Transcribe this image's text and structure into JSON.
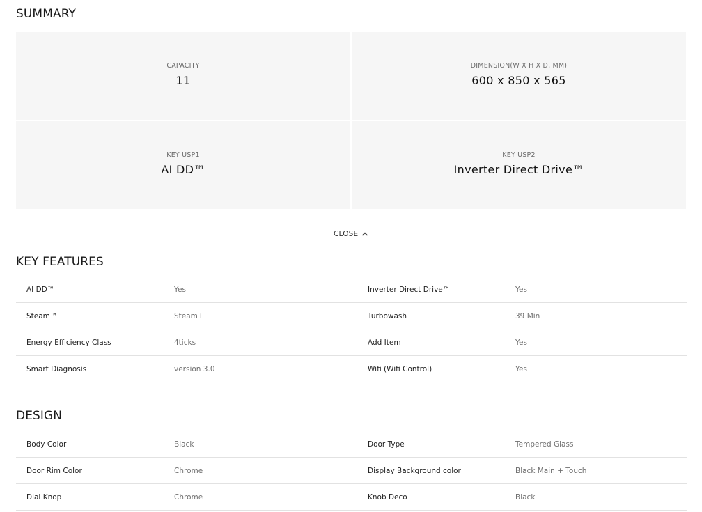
{
  "summary": {
    "title": "SUMMARY",
    "cells": [
      {
        "label": "CAPACITY",
        "value": "11"
      },
      {
        "label": "DIMENSION(W X H X D, MM)",
        "value": "600 x 850 x 565"
      },
      {
        "label": "KEY USP1",
        "value": "AI DD™"
      },
      {
        "label": "KEY USP2",
        "value": "Inverter Direct Drive™"
      }
    ],
    "close_label": "CLOSE"
  },
  "key_features": {
    "title": "KEY FEATURES",
    "rows": [
      [
        {
          "k": "AI DD™",
          "v": "Yes"
        },
        {
          "k": "Inverter Direct Drive™",
          "v": "Yes"
        }
      ],
      [
        {
          "k": "Steam™",
          "v": "Steam+"
        },
        {
          "k": "Turbowash",
          "v": "39 Min"
        }
      ],
      [
        {
          "k": "Energy Efficiency Class",
          "v": "4ticks"
        },
        {
          "k": "Add Item",
          "v": "Yes"
        }
      ],
      [
        {
          "k": "Smart Diagnosis",
          "v": "version 3.0"
        },
        {
          "k": "Wifi (Wifi Control)",
          "v": "Yes"
        }
      ]
    ]
  },
  "design": {
    "title": "DESIGN",
    "rows": [
      [
        {
          "k": "Body Color",
          "v": "Black"
        },
        {
          "k": "Door Type",
          "v": "Tempered Glass"
        }
      ],
      [
        {
          "k": "Door Rim Color",
          "v": "Chrome"
        },
        {
          "k": "Display Background color",
          "v": "Black Main + Touch"
        }
      ],
      [
        {
          "k": "Dial Knop",
          "v": "Chrome"
        },
        {
          "k": "Knob Deco",
          "v": "Black"
        }
      ]
    ]
  },
  "icons": {
    "close": "chevron-up-icon"
  }
}
